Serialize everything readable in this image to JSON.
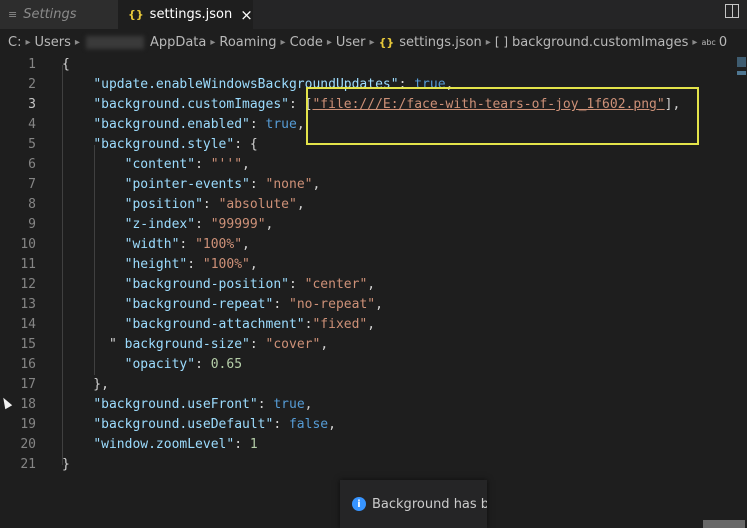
{
  "tabs": [
    {
      "label": "Settings",
      "icon": "settings-lines-icon",
      "active": false
    },
    {
      "label": "settings.json",
      "icon": "json-braces-icon",
      "active": true,
      "close": "×"
    }
  ],
  "breadcrumb": {
    "drive": "C:",
    "items": [
      "Users",
      "AppData",
      "Roaming",
      "Code",
      "User",
      "settings.json",
      "background.customImages"
    ],
    "array_marker": "[ ]",
    "file_icon": "{}",
    "value_icon": "abc",
    "last": "0"
  },
  "lines": [
    {
      "n": "1",
      "tokens": [
        {
          "t": "p",
          "v": "{"
        }
      ]
    },
    {
      "n": "2",
      "tokens": [
        {
          "t": "p",
          "v": "    "
        },
        {
          "t": "k",
          "v": "\"update.enableWindowsBackgroundUpdates\""
        },
        {
          "t": "p",
          "v": ": "
        },
        {
          "t": "b",
          "v": "true"
        },
        {
          "t": "p",
          "v": ","
        }
      ]
    },
    {
      "n": "3",
      "tokens": [
        {
          "t": "p",
          "v": "    "
        },
        {
          "t": "k",
          "v": "\"background.customImages\""
        },
        {
          "t": "p",
          "v": ": ["
        },
        {
          "t": "s",
          "v": "\"file:///E:/face-with-tears-of-joy_1f602.png\"",
          "u": true
        },
        {
          "t": "p",
          "v": "],"
        }
      ]
    },
    {
      "n": "4",
      "tokens": [
        {
          "t": "p",
          "v": "    "
        },
        {
          "t": "k",
          "v": "\"background.enabled\""
        },
        {
          "t": "p",
          "v": ": "
        },
        {
          "t": "b",
          "v": "true"
        },
        {
          "t": "p",
          "v": ","
        }
      ]
    },
    {
      "n": "5",
      "tokens": [
        {
          "t": "p",
          "v": "    "
        },
        {
          "t": "k",
          "v": "\"background.style\""
        },
        {
          "t": "p",
          "v": ": {"
        }
      ]
    },
    {
      "n": "6",
      "tokens": [
        {
          "t": "p",
          "v": "        "
        },
        {
          "t": "k",
          "v": "\"content\""
        },
        {
          "t": "p",
          "v": ": "
        },
        {
          "t": "s",
          "v": "\"''\""
        },
        {
          "t": "p",
          "v": ","
        }
      ]
    },
    {
      "n": "7",
      "tokens": [
        {
          "t": "p",
          "v": "        "
        },
        {
          "t": "k",
          "v": "\"pointer-events\""
        },
        {
          "t": "p",
          "v": ": "
        },
        {
          "t": "s",
          "v": "\"none\""
        },
        {
          "t": "p",
          "v": ","
        }
      ]
    },
    {
      "n": "8",
      "tokens": [
        {
          "t": "p",
          "v": "        "
        },
        {
          "t": "k",
          "v": "\"position\""
        },
        {
          "t": "p",
          "v": ": "
        },
        {
          "t": "s",
          "v": "\"absolute\""
        },
        {
          "t": "p",
          "v": ","
        }
      ]
    },
    {
      "n": "9",
      "tokens": [
        {
          "t": "p",
          "v": "        "
        },
        {
          "t": "k",
          "v": "\"z-index\""
        },
        {
          "t": "p",
          "v": ": "
        },
        {
          "t": "s",
          "v": "\"99999\""
        },
        {
          "t": "p",
          "v": ","
        }
      ]
    },
    {
      "n": "10",
      "tokens": [
        {
          "t": "p",
          "v": "        "
        },
        {
          "t": "k",
          "v": "\"width\""
        },
        {
          "t": "p",
          "v": ": "
        },
        {
          "t": "s",
          "v": "\"100%\""
        },
        {
          "t": "p",
          "v": ","
        }
      ]
    },
    {
      "n": "11",
      "tokens": [
        {
          "t": "p",
          "v": "        "
        },
        {
          "t": "k",
          "v": "\"height\""
        },
        {
          "t": "p",
          "v": ": "
        },
        {
          "t": "s",
          "v": "\"100%\""
        },
        {
          "t": "p",
          "v": ","
        }
      ]
    },
    {
      "n": "12",
      "tokens": [
        {
          "t": "p",
          "v": "        "
        },
        {
          "t": "k",
          "v": "\"background-position\""
        },
        {
          "t": "p",
          "v": ": "
        },
        {
          "t": "s",
          "v": "\"center\""
        },
        {
          "t": "p",
          "v": ","
        }
      ]
    },
    {
      "n": "13",
      "tokens": [
        {
          "t": "p",
          "v": "        "
        },
        {
          "t": "k",
          "v": "\"background-repeat\""
        },
        {
          "t": "p",
          "v": ": "
        },
        {
          "t": "s",
          "v": "\"no-repeat\""
        },
        {
          "t": "p",
          "v": ","
        }
      ]
    },
    {
      "n": "14",
      "tokens": [
        {
          "t": "p",
          "v": "        "
        },
        {
          "t": "k",
          "v": "\"background-attachment\""
        },
        {
          "t": "p",
          "v": ":"
        },
        {
          "t": "s",
          "v": "\"fixed\""
        },
        {
          "t": "p",
          "v": ","
        }
      ]
    },
    {
      "n": "15",
      "tokens": [
        {
          "t": "p",
          "v": "      \" "
        },
        {
          "t": "k",
          "v": "background-size\""
        },
        {
          "t": "p",
          "v": ": "
        },
        {
          "t": "s",
          "v": "\"cover\""
        },
        {
          "t": "p",
          "v": ","
        }
      ]
    },
    {
      "n": "16",
      "tokens": [
        {
          "t": "p",
          "v": "        "
        },
        {
          "t": "k",
          "v": "\"opacity\""
        },
        {
          "t": "p",
          "v": ": "
        },
        {
          "t": "n",
          "v": "0.65"
        }
      ]
    },
    {
      "n": "17",
      "tokens": [
        {
          "t": "p",
          "v": "    },"
        }
      ]
    },
    {
      "n": "18",
      "tokens": [
        {
          "t": "p",
          "v": "    "
        },
        {
          "t": "k",
          "v": "\"background.useFront\""
        },
        {
          "t": "p",
          "v": ": "
        },
        {
          "t": "b",
          "v": "true"
        },
        {
          "t": "p",
          "v": ","
        }
      ]
    },
    {
      "n": "19",
      "tokens": [
        {
          "t": "p",
          "v": "    "
        },
        {
          "t": "k",
          "v": "\"background.useDefault\""
        },
        {
          "t": "p",
          "v": ": "
        },
        {
          "t": "b",
          "v": "false"
        },
        {
          "t": "p",
          "v": ","
        }
      ]
    },
    {
      "n": "20",
      "tokens": [
        {
          "t": "p",
          "v": "    "
        },
        {
          "t": "k",
          "v": "\"window.zoomLevel\""
        },
        {
          "t": "p",
          "v": ": "
        },
        {
          "t": "n",
          "v": "1"
        }
      ]
    },
    {
      "n": "21",
      "tokens": [
        {
          "t": "p",
          "v": "}"
        }
      ]
    }
  ],
  "current_line": "3",
  "notification": {
    "text": "Background has be",
    "icon": "info-icon"
  },
  "colors": {
    "editor_bg": "#1e1e1e",
    "key": "#9cdcfe",
    "string": "#ce9178",
    "boolean": "#569cd6",
    "number": "#b5cea8",
    "highlight_box": "#e3e34a"
  }
}
